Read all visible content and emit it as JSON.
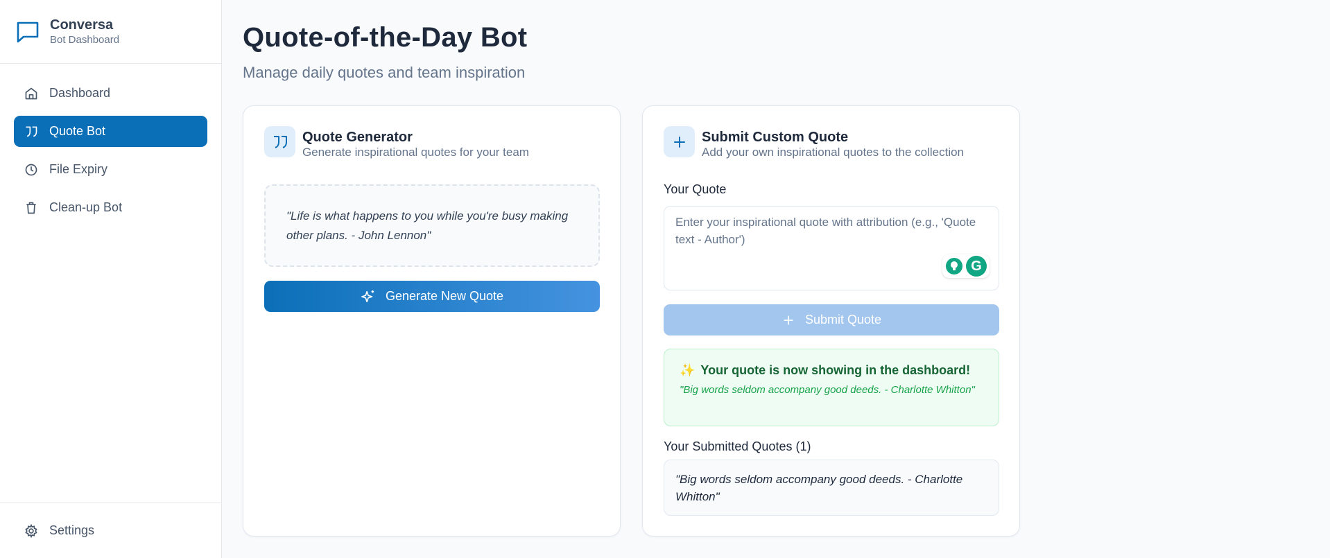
{
  "sidebar": {
    "brand": {
      "name": "Conversa",
      "subtitle": "Bot Dashboard"
    },
    "items": [
      {
        "label": "Dashboard",
        "icon": "home-icon",
        "active": false
      },
      {
        "label": "Quote Bot",
        "icon": "quote-icon",
        "active": true
      },
      {
        "label": "File Expiry",
        "icon": "clock-icon",
        "active": false
      },
      {
        "label": "Clean-up Bot",
        "icon": "trash-icon",
        "active": false
      }
    ],
    "settings_label": "Settings"
  },
  "header": {
    "title": "Quote-of-the-Day Bot",
    "subtitle": "Manage daily quotes and team inspiration"
  },
  "generator": {
    "title": "Quote Generator",
    "subtitle": "Generate inspirational quotes for your team",
    "current_quote": "\"Life is what happens to you while you're busy making other plans. - John Lennon\"",
    "button_label": "Generate New Quote"
  },
  "submit": {
    "title": "Submit Custom Quote",
    "subtitle": "Add your own inspirational quotes to the collection",
    "field_label": "Your Quote",
    "placeholder": "Enter your inspirational quote with attribution (e.g., 'Quote text - Author')",
    "value": "",
    "button_label": "Submit Quote",
    "success_title": "Your quote is now showing in the dashboard!",
    "success_emoji": "✨",
    "success_quote": "\"Big words seldom accompany good deeds. - Charlotte Whitton\"",
    "submitted_label": "Your Submitted Quotes (1)",
    "submitted_quotes": [
      "\"Big words seldom accompany good deeds. - Charlotte Whitton\""
    ]
  },
  "colors": {
    "accent": "#0b6fb8",
    "accent_light": "#4593e0",
    "success_bg": "#effcf3",
    "success_text": "#166534"
  }
}
